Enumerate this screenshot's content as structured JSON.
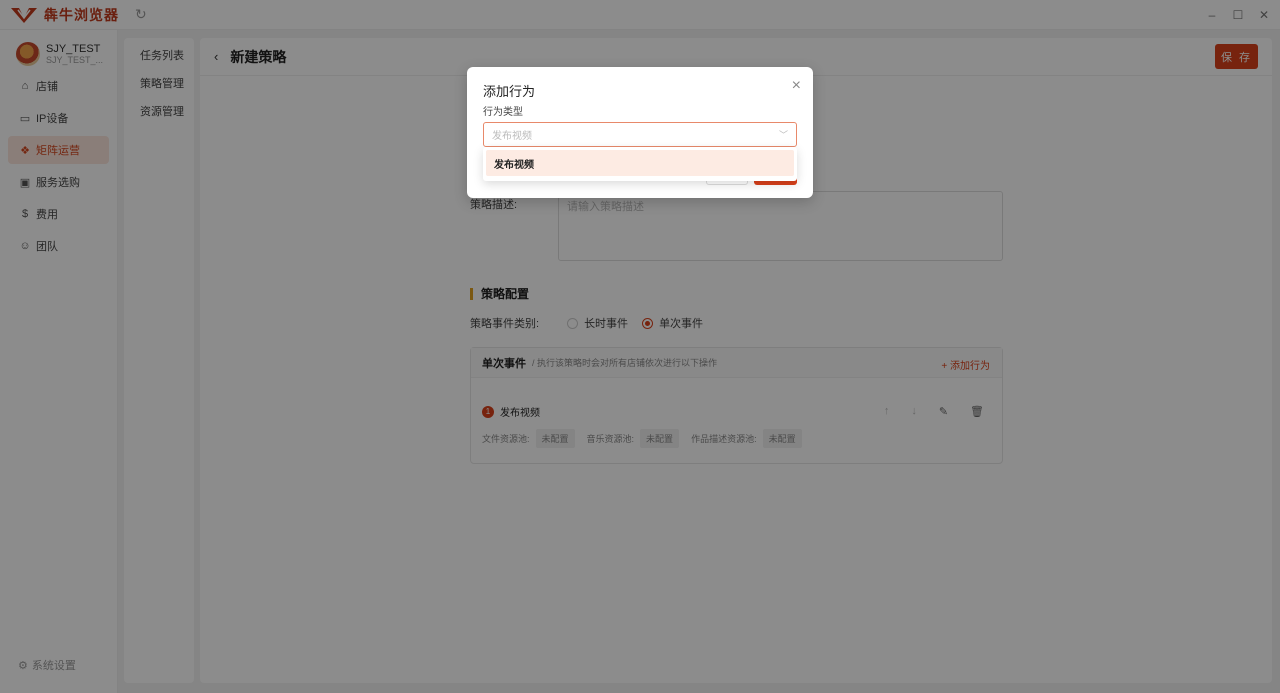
{
  "app": {
    "title": "犇牛浏览器",
    "refresh_icon": "refresh-icon"
  },
  "window": {
    "minimize": "–",
    "maximize": "☐",
    "close": "✕"
  },
  "user": {
    "name": "SJY_TEST",
    "sub": "SJY_TEST_..."
  },
  "sidebar": {
    "items": [
      {
        "label": "店铺",
        "icon": "store-icon"
      },
      {
        "label": "IP设备",
        "icon": "device-icon"
      },
      {
        "label": "矩阵运营",
        "icon": "matrix-icon",
        "active": true
      },
      {
        "label": "服务选购",
        "icon": "bag-icon"
      },
      {
        "label": "费用",
        "icon": "fee-icon"
      },
      {
        "label": "团队",
        "icon": "team-icon"
      }
    ],
    "settings": "系统设置"
  },
  "submenu": {
    "items": [
      "任务列表",
      "策略管理",
      "资源管理"
    ]
  },
  "main": {
    "title": "新建策略",
    "save_label": "保 存",
    "desc_label": "策略描述:",
    "desc_placeholder": "请输入策略描述",
    "section_title": "策略配置",
    "event_type_label": "策略事件类别:",
    "event_types": [
      "长时事件",
      "单次事件"
    ],
    "event_type_selected": "单次事件",
    "event_box": {
      "title": "单次事件",
      "desc": "/ 执行该策略时会对所有店铺依次进行以下操作",
      "add_action": "添加行为",
      "item": {
        "num": "1",
        "label": "发布视频"
      },
      "resources": [
        {
          "label": "文件资源池:",
          "value": "未配置"
        },
        {
          "label": "音乐资源池:",
          "value": "未配置"
        },
        {
          "label": "作品描述资源池:",
          "value": "未配置"
        }
      ]
    }
  },
  "modal": {
    "title": "添加行为",
    "field_label": "行为类型",
    "select_placeholder": "发布视频",
    "options": [
      "发布视频"
    ]
  }
}
